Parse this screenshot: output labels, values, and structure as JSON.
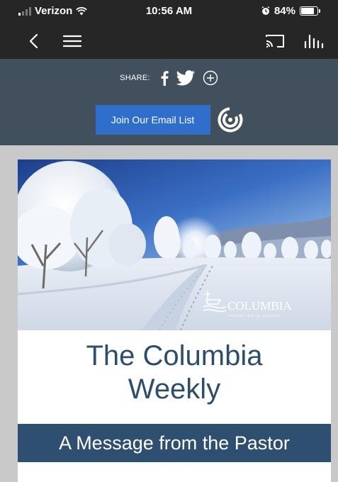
{
  "status_bar": {
    "carrier": "Verizon",
    "time": "10:56 AM",
    "battery": "84%",
    "battery_level": 0.84
  },
  "navbar": {
    "back_icon": "chevron-left-icon",
    "menu_icon": "hamburger-menu-icon",
    "cast_icon": "cast-icon",
    "stats_icon": "bar-chart-icon"
  },
  "share": {
    "label": "SHARE:",
    "icons": [
      "facebook-icon",
      "twitter-icon",
      "plus-circle-icon"
    ]
  },
  "email": {
    "join_label": "Join Our Email List",
    "logo_icon": "constant-contact-logo-icon"
  },
  "newsletter": {
    "logo_text": "COLUMBIA",
    "logo_subtext": "PRESBYTERIAN CHURCH",
    "title_line1": "The Columbia",
    "title_line2": "Weekly",
    "section_heading": "A Message from the Pastor"
  },
  "colors": {
    "status_bg": "#262626",
    "header_bg": "#42505e",
    "join_button": "#2f6fcb",
    "title_text": "#2e4d6b",
    "banner_bg": "#2e4f6f",
    "page_bg": "#c9c9c9"
  }
}
